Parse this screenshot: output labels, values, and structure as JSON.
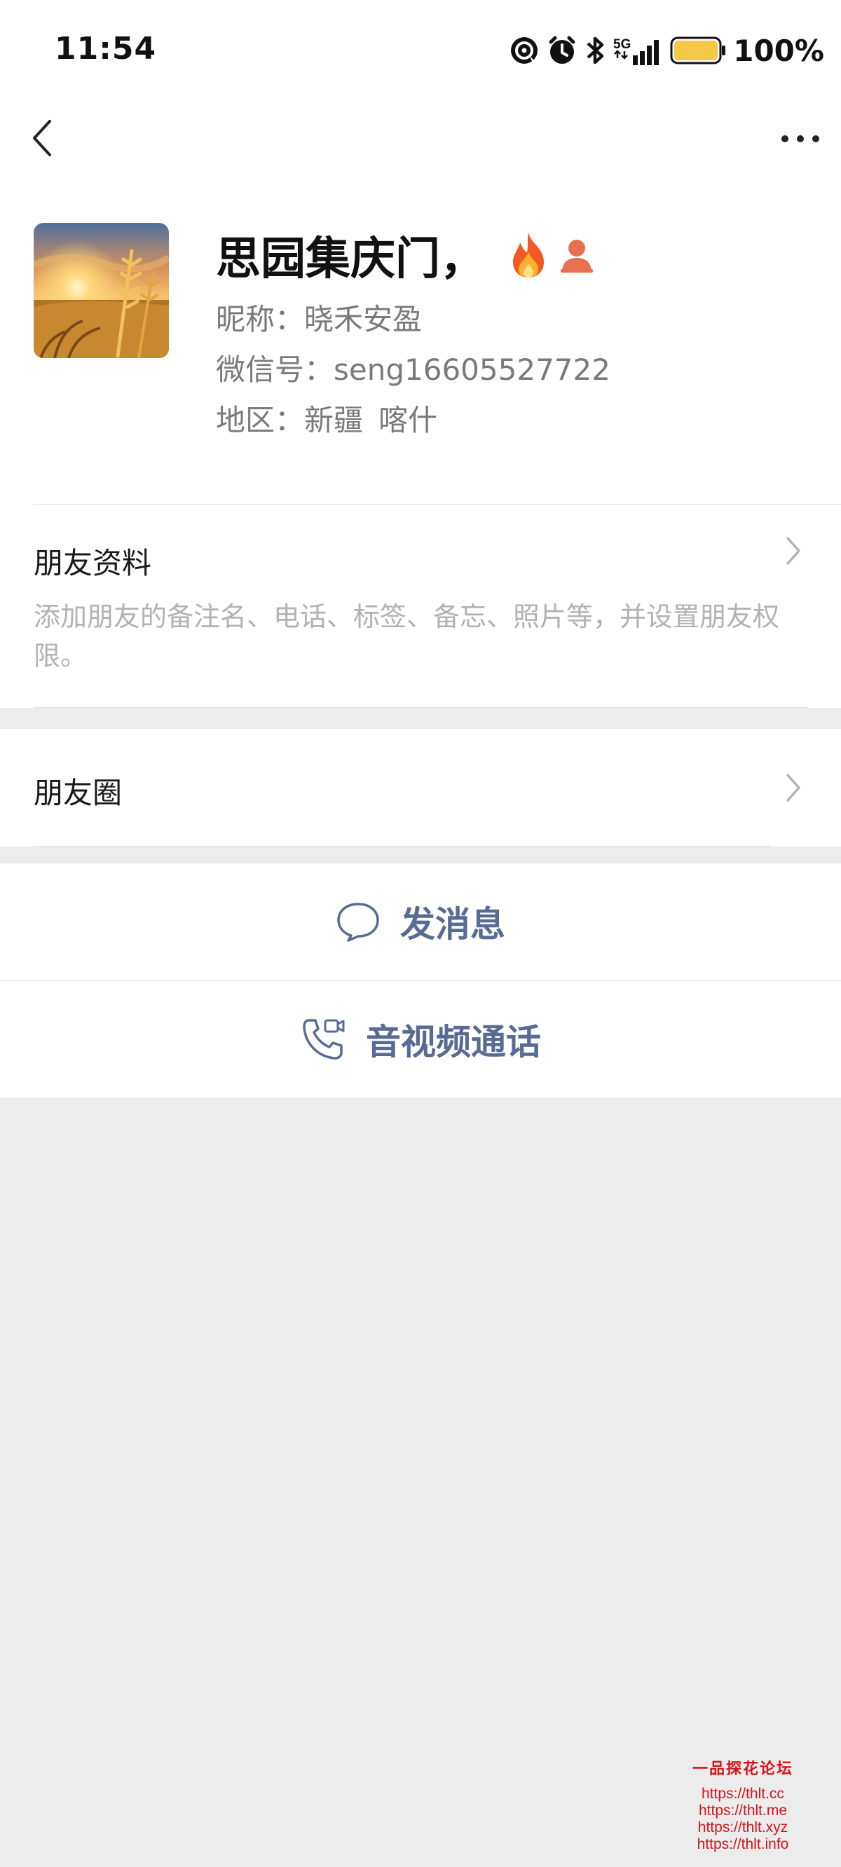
{
  "status_bar": {
    "time": "11:54",
    "network": "5G",
    "battery_percent": "100%",
    "battery_level": 1.0,
    "icons": [
      "hotspot-icon",
      "alarm-icon",
      "bluetooth-icon",
      "signal-5g-icon",
      "battery-icon"
    ]
  },
  "nav": {
    "back_icon": "chevron-left-icon",
    "more_icon": "more-dots-icon"
  },
  "profile": {
    "name": "思园集庆门，",
    "badges": [
      "fire-emoji",
      "person-icon"
    ],
    "nickname_label": "昵称：",
    "nickname": "晓禾安盈",
    "wechat_id_label": "微信号：",
    "wechat_id": "seng16605527722",
    "region_label": "地区：",
    "region_province": "新疆",
    "region_city": "喀什"
  },
  "friend_info": {
    "title": "朋友资料",
    "description": "添加朋友的备注名、电话、标签、备忘、照片等，并设置朋友权限。"
  },
  "moments": {
    "title": "朋友圈"
  },
  "actions": {
    "send_message": "发消息",
    "av_call": "音视频通话"
  },
  "watermark": {
    "title": "一品探花论坛",
    "lines": [
      "https://thlt.cc",
      "https://thlt.me",
      "https://thlt.xyz",
      "https://thlt.info"
    ]
  },
  "colors": {
    "link_blue": "#576b95",
    "background": "#ececec",
    "battery": "#f7c948",
    "badge_orange": "#e9704f"
  }
}
